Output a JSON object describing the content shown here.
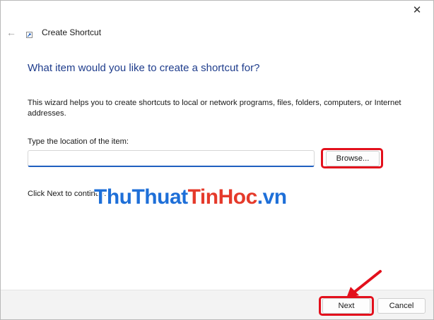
{
  "window": {
    "title": "Create Shortcut",
    "close_glyph": "✕",
    "back_glyph": "←"
  },
  "main": {
    "heading": "What item would you like to create a shortcut for?",
    "description": "This wizard helps you to create shortcuts to local or network programs, files, folders, computers, or Internet addresses.",
    "location_label": "Type the location of the item:",
    "location_value": "",
    "browse_label": "Browse...",
    "next_info": "Click Next to continue."
  },
  "watermark": {
    "part1": "ThuThuat",
    "part2": "TinHoc",
    "part3": ".vn"
  },
  "footer": {
    "next_label": "Next",
    "cancel_label": "Cancel"
  },
  "colors": {
    "heading": "#1f3d8c",
    "highlight": "#e3101c",
    "input_accent": "#1f5fbf",
    "watermark_blue": "#1e6fd8",
    "watermark_red": "#e53a2b"
  }
}
